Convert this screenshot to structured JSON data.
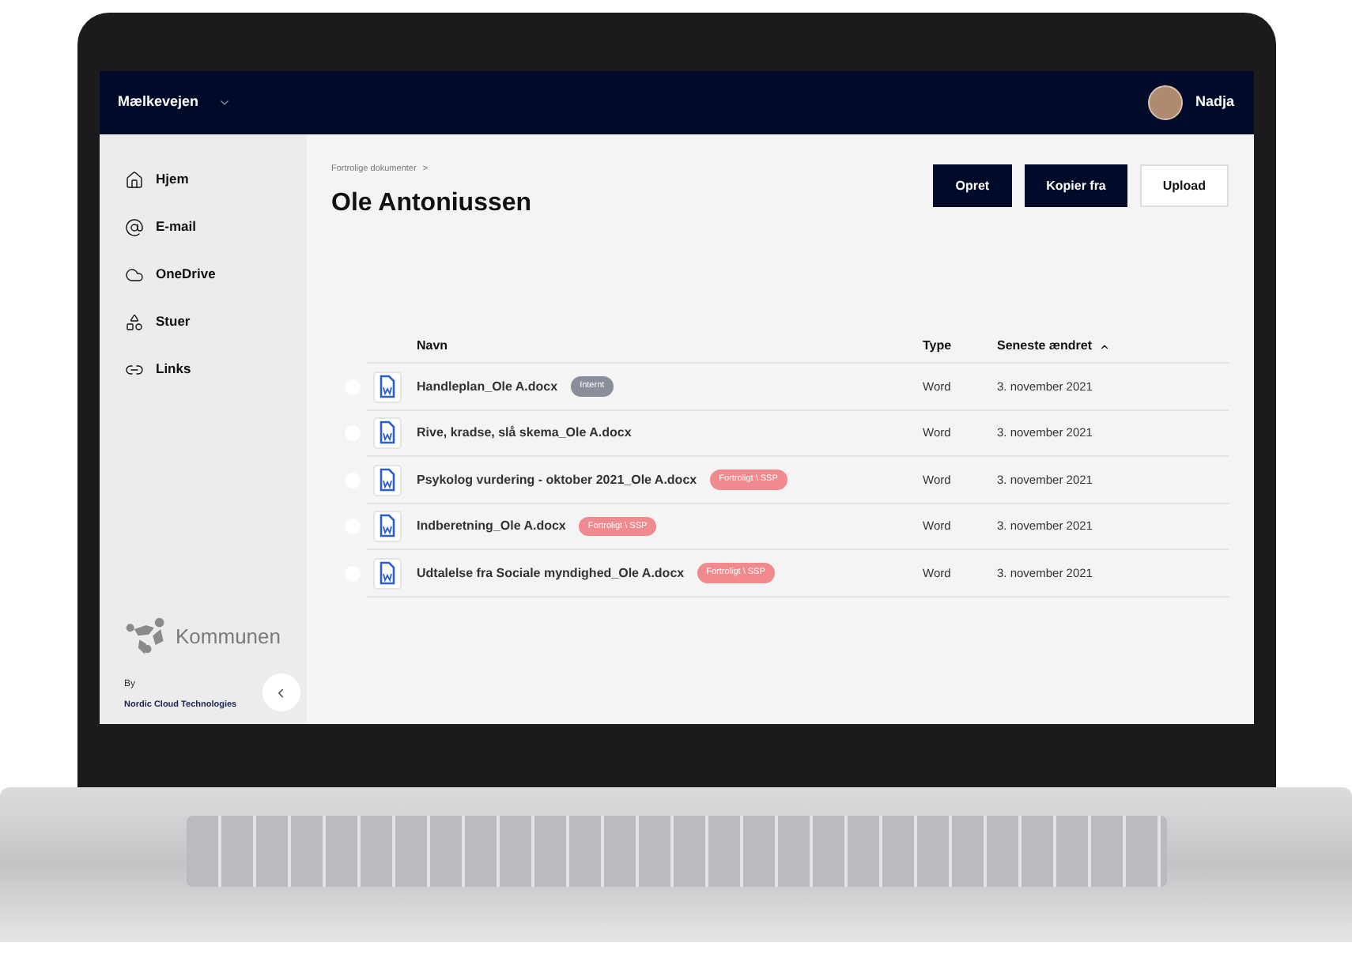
{
  "topbar": {
    "workspace": "Mælkevejen",
    "user": "Nadja"
  },
  "sidebar": {
    "items": [
      {
        "label": "Hjem",
        "kind": "home"
      },
      {
        "label": "E-mail",
        "kind": "mail"
      },
      {
        "label": "OneDrive",
        "kind": "cloud"
      },
      {
        "label": "Stuer",
        "kind": "rooms"
      },
      {
        "label": "Links",
        "kind": "links"
      }
    ],
    "logo": "Kommunen",
    "by": "By",
    "company": "Nordic Cloud Technologies"
  },
  "breadcrumb": "Fortrolige dokumenter",
  "breadcrumb_separator": ">",
  "title": "Ole Antoniussen",
  "buttons": [
    {
      "label": "Opret",
      "kind": "primary"
    },
    {
      "label": "Kopier fra",
      "kind": "primary"
    },
    {
      "label": "Upload",
      "kind": "secondary"
    }
  ],
  "table": {
    "columns": [
      "Navn",
      "Type",
      "Seneste ændret"
    ],
    "rows": [
      {
        "name": "Handleplan_Ole A.docx",
        "tag": {
          "label": "Internt",
          "color": "#8a8d9a"
        },
        "type": "Word",
        "modified": "3. november 2021",
        "selected": false
      },
      {
        "name": "Rive, kradse, slå skema_Ole A.docx",
        "type": "Word",
        "modified": "3. november 2021",
        "selected": false
      },
      {
        "name": "Psykolog vurdering - oktober 2021_Ole A.docx",
        "tag": {
          "label": "Fortroligt \\ SSP",
          "color": "#f08a8f"
        },
        "type": "Word",
        "modified": "3. november 2021",
        "selected": false
      },
      {
        "name": "Indberetning_Ole A.docx",
        "tag": {
          "label": "Fortroligt \\ SSP",
          "color": "#f08a8f"
        },
        "type": "Word",
        "modified": "3. november 2021",
        "selected": false
      },
      {
        "name": "Udtalelse fra Sociale myndighed_Ole A.docx",
        "tag": {
          "label": "Fortroligt \\ SSP",
          "color": "#f08a8f"
        },
        "type": "Word",
        "modified": "3. november 2021",
        "selected": false
      }
    ]
  }
}
